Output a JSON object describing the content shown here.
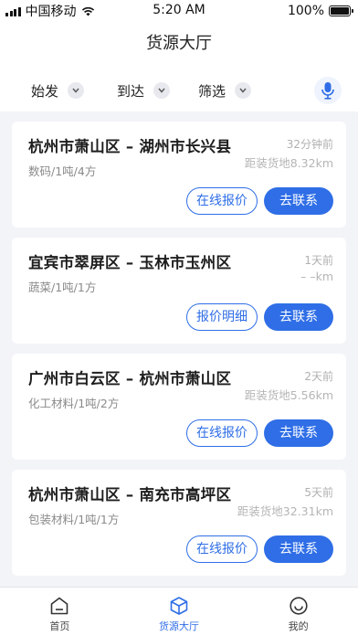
{
  "status_bar": {
    "carrier": "中国移动",
    "time": "5:20 AM",
    "battery": "100%"
  },
  "header": {
    "title": "货源大厅"
  },
  "filters": {
    "origin": "始发",
    "destination": "到达",
    "filter": "筛选"
  },
  "cards": [
    {
      "route": "杭州市萧山区 – 湖州市长兴县",
      "meta": "数码/1吨/4方",
      "time": "32分钟前",
      "distance": "距装货地8.32km",
      "secondary_label": "在线报价",
      "primary_label": "去联系"
    },
    {
      "route": "宜宾市翠屏区 – 玉林市玉州区",
      "meta": "蔬菜/1吨/1方",
      "time": "1天前",
      "distance": "– –km",
      "secondary_label": "报价明细",
      "primary_label": "去联系"
    },
    {
      "route": "广州市白云区 – 杭州市萧山区",
      "meta": "化工材料/1吨/2方",
      "time": "2天前",
      "distance": "距装货地5.56km",
      "secondary_label": "在线报价",
      "primary_label": "去联系"
    },
    {
      "route": "杭州市萧山区 – 南充市高坪区",
      "meta": "包装材料/1吨/1方",
      "time": "5天前",
      "distance": "距装货地32.31km",
      "secondary_label": "在线报价",
      "primary_label": "去联系"
    }
  ],
  "tabbar": {
    "home": "首页",
    "cargo": "货源大厅",
    "mine": "我的"
  },
  "colors": {
    "accent": "#2f6ee6",
    "background": "#f3f4f8"
  }
}
